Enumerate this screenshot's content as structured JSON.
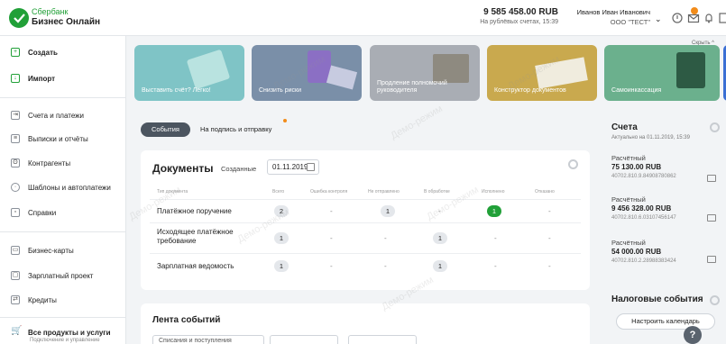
{
  "brand": {
    "line1": "Сбербанк",
    "line2": "Бизнес Онлайн"
  },
  "header": {
    "balance": "9 585 458.00 RUB",
    "balance_sub": "На рублёвых счетах, 15:39",
    "user_name": "Иванов Иван Иванович",
    "org": "ООО \"ТЕСТ\"",
    "notifications_badge": ""
  },
  "sidebar": {
    "items": [
      {
        "label": "Создать",
        "icon": "create-doc-icon"
      },
      {
        "label": "Импорт",
        "icon": "import-doc-icon"
      },
      {
        "label": "Счета и платежи",
        "icon": "transfer-icon"
      },
      {
        "label": "Выписки и отчёты",
        "icon": "report-icon"
      },
      {
        "label": "Контрагенты",
        "icon": "contact-icon"
      },
      {
        "label": "Шаблоны и автоплатежи",
        "icon": "clock-icon"
      },
      {
        "label": "Справки",
        "icon": "document-icon"
      },
      {
        "label": "Бизнес-карты",
        "icon": "card-icon"
      },
      {
        "label": "Зарплатный проект",
        "icon": "salary-icon"
      },
      {
        "label": "Кредиты",
        "icon": "credit-icon"
      },
      {
        "label": "Все продукты и услуги",
        "icon": "cart-icon"
      }
    ],
    "all_products_sub": "Подключение и управление"
  },
  "banners": {
    "hide_label": "Скрыть ^",
    "items": [
      {
        "text": "Выставить счёт? Легко!",
        "color": "#7fc4c6"
      },
      {
        "text": "Снизить риски",
        "color": "#7a8fa8"
      },
      {
        "text": "Продление полномочий руководителя",
        "color": "#a9adb4"
      },
      {
        "text": "Конструктор документов",
        "color": "#c9a94e"
      },
      {
        "text": "Самоинкассация",
        "color": "#6bb08d"
      }
    ]
  },
  "tabs": {
    "active": "События",
    "other": "На подпись и отправку"
  },
  "documents": {
    "title": "Документы",
    "created_label": "Созданные",
    "date": "01.11.2019",
    "columns": [
      "Тип документа",
      "Всего",
      "Ошибка контроля",
      "Не отправлено",
      "В обработке",
      "Исполнено",
      "Отказано"
    ],
    "rows": [
      {
        "type": "Платёжное поручение",
        "total": "2",
        "error": "-",
        "not_sent": "1",
        "processing": "-",
        "done": "1",
        "rejected": "-"
      },
      {
        "type": "Исходящее платёжное требование",
        "total": "1",
        "error": "-",
        "not_sent": "-",
        "processing": "1",
        "done": "-",
        "rejected": "-"
      },
      {
        "type": "Зарплатная ведомость",
        "total": "1",
        "error": "-",
        "not_sent": "-",
        "processing": "1",
        "done": "-",
        "rejected": "-"
      }
    ]
  },
  "feed": {
    "title": "Лента событий",
    "filter1": "Списания и поступления",
    "filter2": "",
    "filter3": ""
  },
  "accounts": {
    "title": "Счета",
    "subtitle": "Актуально на 01.11.2019, 15:39",
    "items": [
      {
        "type": "Расчётный",
        "amount": "75 130.00 RUB",
        "number": "40702.810.9.84908780862"
      },
      {
        "type": "Расчётный",
        "amount": "9 456 328.00 RUB",
        "number": "40702.810.6.03107456147"
      },
      {
        "type": "Расчётный",
        "amount": "54 000.00 RUB",
        "number": "40702.810.2.28988383424"
      }
    ]
  },
  "tax": {
    "title": "Налоговые события",
    "calendar_btn": "Настроить календарь"
  },
  "help_label": "?",
  "watermark": "Демо-режим",
  "colors": {
    "brand_green": "#21a038",
    "accent_orange": "#f28c1a",
    "dark_tab": "#4c5560"
  }
}
